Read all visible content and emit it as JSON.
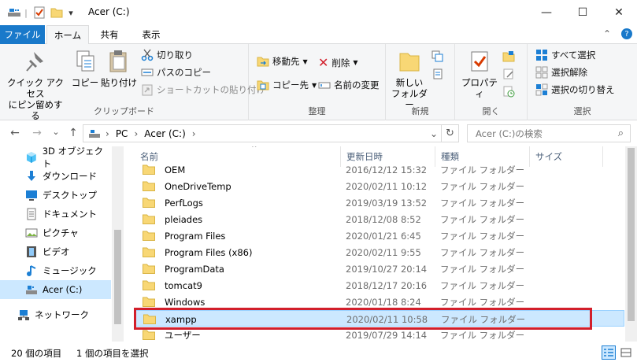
{
  "window": {
    "title": "Acer (C:)",
    "minimize": "—",
    "maximize": "☐",
    "close": "✕"
  },
  "quick_access": {
    "dropdown": "▾",
    "separator": "|"
  },
  "ribbon_tabs": [
    "ファイル",
    "ホーム",
    "共有",
    "表示"
  ],
  "ribbon_right": {
    "collapse": "⌃",
    "help": "?"
  },
  "ribbon": {
    "clipboard": {
      "label": "クリップボード",
      "pin_line1": "クイック アクセス",
      "pin_line2": "にピン留めする",
      "copy": "コピー",
      "paste": "貼り付け",
      "cut": "切り取り",
      "copy_path": "パスのコピー",
      "paste_shortcut": "ショートカットの貼り付け"
    },
    "organize": {
      "label": "整理",
      "move_to": "移動先",
      "delete": "削除",
      "copy_to": "コピー先",
      "rename": "名前の変更"
    },
    "new": {
      "label": "新規",
      "new_folder_line1": "新しい",
      "new_folder_line2": "フォルダー"
    },
    "open": {
      "label": "開く",
      "properties": "プロパティ"
    },
    "select": {
      "label": "選択",
      "select_all": "すべて選択",
      "select_none": "選択解除",
      "invert": "選択の切り替え"
    }
  },
  "address_bar": {
    "back": "←",
    "forward": "→",
    "recent": "⌄",
    "up": "↑",
    "crumbs": [
      "PC",
      "Acer (C:)"
    ],
    "separator": "›",
    "dropdown": "⌄",
    "refresh": "↻",
    "search_placeholder": "Acer (C:)の検索",
    "search_icon": "⌕"
  },
  "nav_pane": [
    {
      "label": "3D オブジェクト",
      "icon": "cube-icon"
    },
    {
      "label": "ダウンロード",
      "icon": "download-icon"
    },
    {
      "label": "デスクトップ",
      "icon": "desktop-icon"
    },
    {
      "label": "ドキュメント",
      "icon": "document-icon"
    },
    {
      "label": "ピクチャ",
      "icon": "picture-icon"
    },
    {
      "label": "ビデオ",
      "icon": "video-icon"
    },
    {
      "label": "ミュージック",
      "icon": "music-icon"
    },
    {
      "label": "Acer (C:)",
      "icon": "drive-icon",
      "selected": true
    },
    {
      "label": "ネットワーク",
      "icon": "network-icon"
    }
  ],
  "columns": {
    "name": "名前",
    "modified": "更新日時",
    "type": "種類",
    "size": "サイズ",
    "sort_arrow": "^"
  },
  "files": [
    {
      "name": "OEM",
      "modified": "2016/12/12 15:32",
      "type": "ファイル フォルダー"
    },
    {
      "name": "OneDriveTemp",
      "modified": "2020/02/11 10:12",
      "type": "ファイル フォルダー"
    },
    {
      "name": "PerfLogs",
      "modified": "2019/03/19 13:52",
      "type": "ファイル フォルダー"
    },
    {
      "name": "pleiades",
      "modified": "2018/12/08 8:52",
      "type": "ファイル フォルダー"
    },
    {
      "name": "Program Files",
      "modified": "2020/01/21 6:45",
      "type": "ファイル フォルダー"
    },
    {
      "name": "Program Files (x86)",
      "modified": "2020/02/11 9:55",
      "type": "ファイル フォルダー"
    },
    {
      "name": "ProgramData",
      "modified": "2019/10/27 20:14",
      "type": "ファイル フォルダー"
    },
    {
      "name": "tomcat9",
      "modified": "2018/12/17 20:16",
      "type": "ファイル フォルダー"
    },
    {
      "name": "Windows",
      "modified": "2020/01/18 8:24",
      "type": "ファイル フォルダー"
    },
    {
      "name": "xampp",
      "modified": "2020/02/11 10:58",
      "type": "ファイル フォルダー",
      "selected": true
    },
    {
      "name": "ユーザー",
      "modified": "2019/07/29 14:14",
      "type": "ファイル フォルダー"
    }
  ],
  "status": {
    "item_count": "20 個の項目",
    "selected_count": "1 個の項目を選択"
  },
  "colors": {
    "file_tab": "#1979ca",
    "selection": "#cce8ff",
    "highlight_border": "#d21f2b",
    "folder": "#f8d775"
  }
}
